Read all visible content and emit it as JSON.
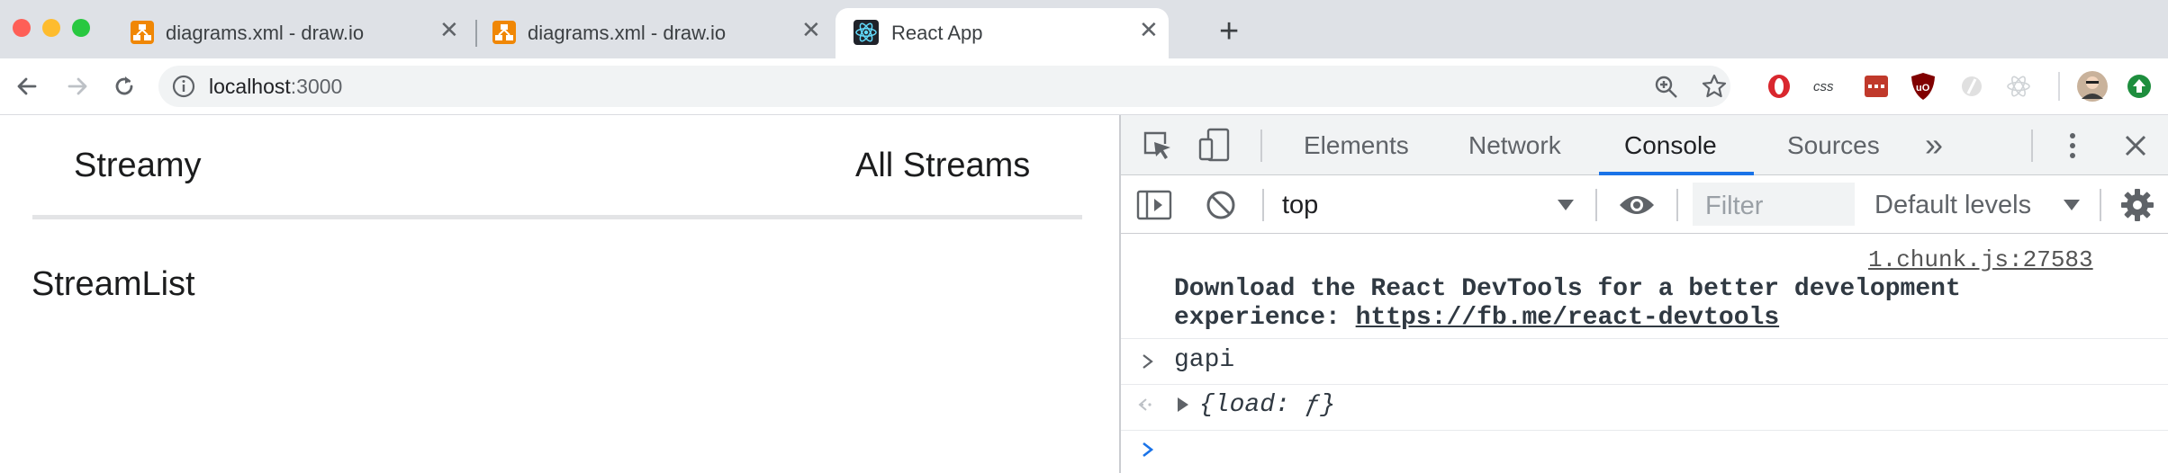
{
  "browser": {
    "tabs": [
      {
        "title": "diagrams.xml - draw.io",
        "active": false
      },
      {
        "title": "diagrams.xml - draw.io",
        "active": false
      },
      {
        "title": "React App",
        "active": true
      }
    ],
    "new_tab_symbol": "+",
    "close_symbol": "✕",
    "address": {
      "host": "localhost",
      "port": ":3000"
    }
  },
  "page": {
    "brand": "Streamy",
    "nav_link": "All Streams",
    "heading": "StreamList"
  },
  "devtools": {
    "tabs": [
      "Elements",
      "Network",
      "Console",
      "Sources"
    ],
    "active_tab": "Console",
    "more_symbol": "»",
    "context": "top",
    "filter_placeholder": "Filter",
    "levels": "Default levels",
    "console": {
      "source_link": "1.chunk.js:27583",
      "message_line1": "Download the React DevTools for a better development",
      "message_prefix": "experience: ",
      "message_link": "https://fb.me/react-devtools",
      "input_command": "gapi",
      "result": "{load: ƒ}"
    }
  },
  "colors": {
    "tab_strip": "#dee1e6",
    "active_tab_underline": "#1a73e8",
    "console_prompt": "#1a73e8"
  }
}
